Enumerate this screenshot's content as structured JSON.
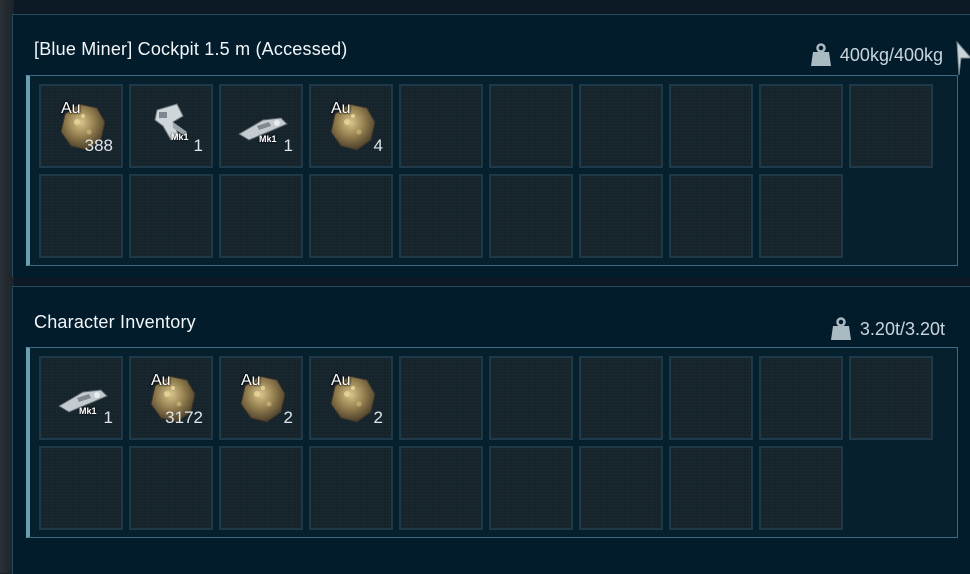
{
  "cockpit": {
    "title": "[Blue Miner] Cockpit 1.5 m (Accessed)",
    "weight": "400kg/400kg",
    "weight_icon": "weight-icon",
    "total_slots": 19,
    "items": [
      {
        "icon": "gold-ore-icon",
        "label": "Au",
        "qty": "388"
      },
      {
        "icon": "hand-drill-icon",
        "label": "Mk1",
        "qty": "1"
      },
      {
        "icon": "welder-tool-icon",
        "label": "Mk1",
        "qty": "1"
      },
      {
        "icon": "gold-ore-icon",
        "label": "Au",
        "qty": "4"
      }
    ]
  },
  "character": {
    "title": "Character Inventory",
    "weight": "3.20t/3.20t",
    "weight_icon": "weight-icon",
    "total_slots": 19,
    "items": [
      {
        "icon": "welder-tool-icon",
        "label": "Mk1",
        "qty": "1"
      },
      {
        "icon": "gold-ore-icon",
        "label": "Au",
        "qty": "3172"
      },
      {
        "icon": "gold-ore-icon",
        "label": "Au",
        "qty": "2"
      },
      {
        "icon": "gold-ore-icon",
        "label": "Au",
        "qty": "2"
      }
    ]
  },
  "colors": {
    "panel_bg": "#031c2c",
    "slot_border": "#1e3a4a",
    "accent": "#6a9eb2"
  }
}
